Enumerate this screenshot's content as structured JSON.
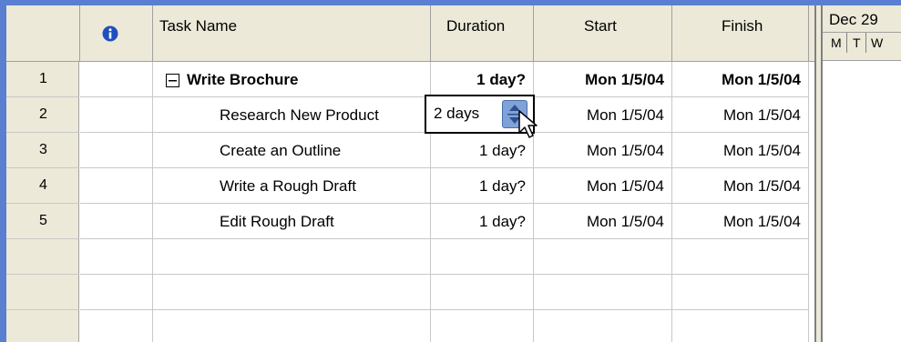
{
  "header": {
    "info_column_icon": "info-icon",
    "task_name": "Task Name",
    "duration": "Duration",
    "start": "Start",
    "finish": "Finish"
  },
  "timescale": {
    "week": "Dec 29",
    "days": [
      "M",
      "T",
      "W"
    ]
  },
  "rows": [
    {
      "id": "1",
      "name": "Write Brochure",
      "duration": "1 day?",
      "start": "Mon 1/5/04",
      "finish": "Mon 1/5/04",
      "summary": true,
      "outline_icon": "collapse-minus-icon"
    },
    {
      "id": "2",
      "name": "Research New Product",
      "duration": "2 days",
      "start": "Mon 1/5/04",
      "finish": "Mon 1/5/04",
      "editing": true
    },
    {
      "id": "3",
      "name": "Create an Outline",
      "duration": "1 day?",
      "start": "Mon 1/5/04",
      "finish": "Mon 1/5/04"
    },
    {
      "id": "4",
      "name": "Write a Rough Draft",
      "duration": "1 day?",
      "start": "Mon 1/5/04",
      "finish": "Mon 1/5/04"
    },
    {
      "id": "5",
      "name": "Edit Rough Draft",
      "duration": "1 day?",
      "start": "Mon 1/5/04",
      "finish": "Mon 1/5/04"
    }
  ],
  "icons": {
    "spinner": "up-down-spinner-icon",
    "cursor": "mouse-pointer-icon"
  },
  "colors": {
    "header_bg": "#ece9d8",
    "frame": "#5b7fd0",
    "info_icon": "#1f4fbf",
    "spinner": "#7fa3d8"
  }
}
